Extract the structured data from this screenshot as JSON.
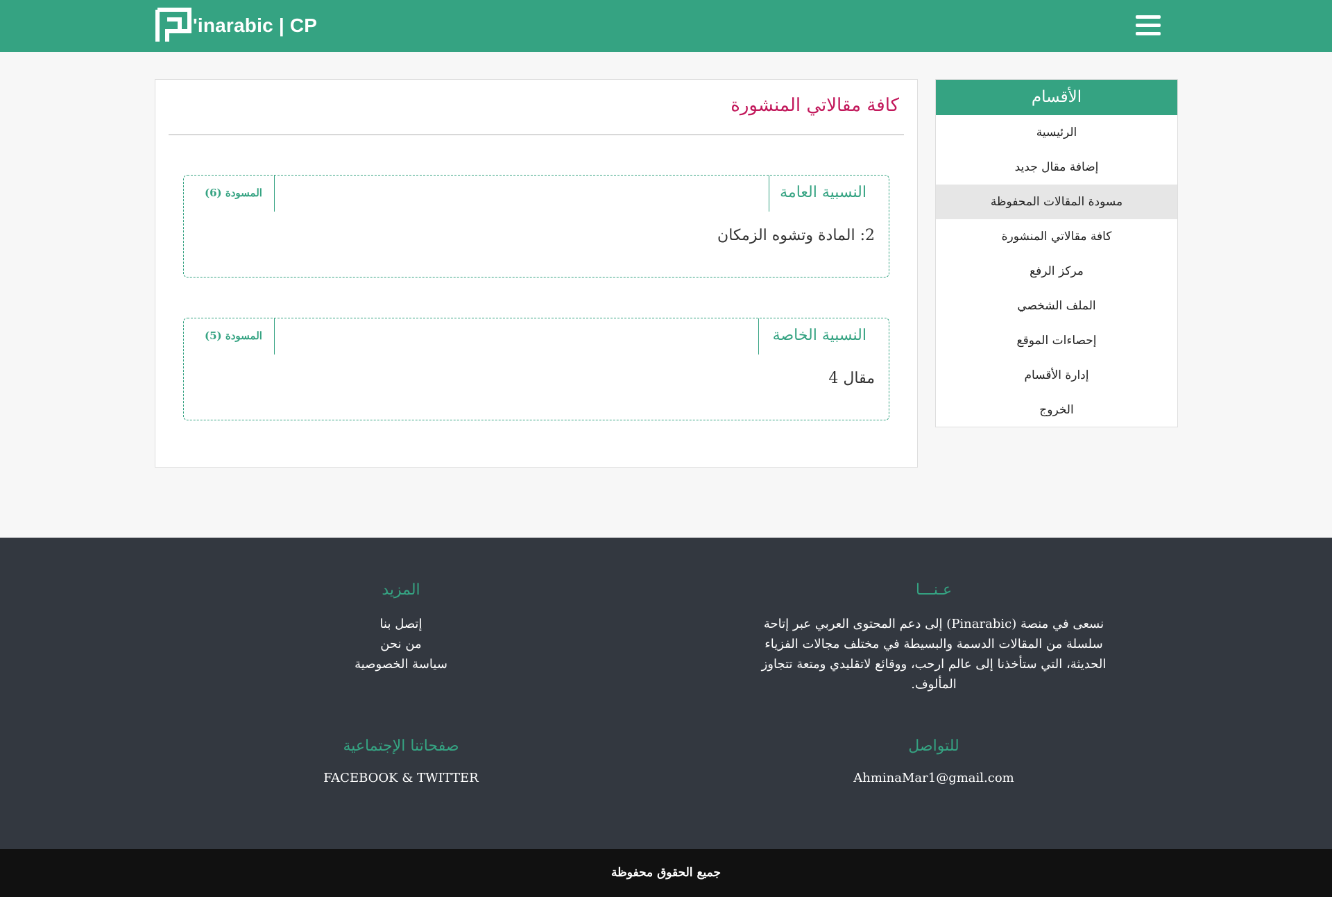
{
  "header": {
    "brand_text": "'inarabic | CP",
    "logo_icon": "pinarabic-logo-icon",
    "menu_icon": "hamburger-menu-icon",
    "accent_color": "#35a382"
  },
  "main": {
    "title": "كافة مقالاتي المنشورة",
    "categories": [
      {
        "name": "النسبية العامة",
        "draft_label": "المسودة (6)",
        "article": "2: المادة وتشوه الزمكان"
      },
      {
        "name": "النسبية الخاصة",
        "draft_label": "المسودة (5)",
        "article": "مقال 4"
      }
    ]
  },
  "sidebar": {
    "header": "الأقسام",
    "items": [
      {
        "label": "الرئيسية"
      },
      {
        "label": "إضافة مقال جديد"
      },
      {
        "label": "مسودة المقالات المحفوظة",
        "active": true
      },
      {
        "label": "كافة مقالاتي المنشورة"
      },
      {
        "label": "مركز الرفع"
      },
      {
        "label": "الملف الشخصي"
      },
      {
        "label": "إحصاءات الموقع"
      },
      {
        "label": "إدارة الأقسام"
      },
      {
        "label": "الخروج"
      }
    ]
  },
  "footer": {
    "about": {
      "heading": "عـنـــا",
      "body": "نسعى في منصة (Pinarabic) إلى دعم المحتوى العربي عبر إتاحة سلسلة من المقالات الدسمة والبسيطة في مختلف مجالات الفزياء الحديثة، التي ستأخذنا إلى عالم ارحب، ووقائع لاتقليدي ومتعة تتجاوز المألوف."
    },
    "more": {
      "heading": "المزيد",
      "links": [
        "إتصل بنا",
        "من نحن",
        "سياسة الخصوصية"
      ]
    },
    "contact": {
      "heading": "للتواصل",
      "email": "AhminaMar1@gmail.com"
    },
    "social": {
      "heading": "صفحاتنا الإجتماعية",
      "text": "FACEBOOK & TWITTER"
    },
    "footer_bg": "#333840"
  },
  "copyright": "جميع الحقوق محفوظة"
}
